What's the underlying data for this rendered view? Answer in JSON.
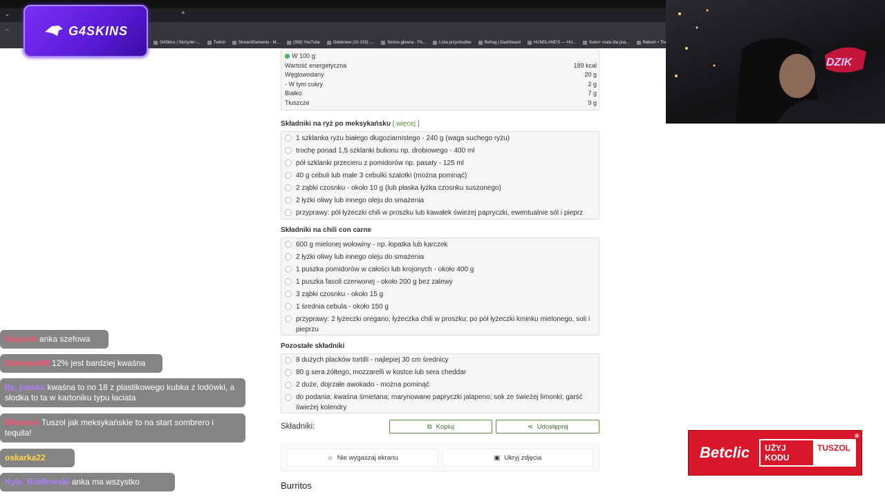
{
  "browser": {
    "new_tab_glyph": "+",
    "nav_back": "←",
    "nav_forward": "→",
    "nav_reload": "↻",
    "bookmarks": [
      {
        "label": "G4Skins | Skrzynki -..."
      },
      {
        "label": "Twitch"
      },
      {
        "label": "StreamElements - M..."
      },
      {
        "label": "(358) YouTube"
      },
      {
        "label": "Odebrane (10 219) -..."
      },
      {
        "label": "Strona główna - FA..."
      },
      {
        "label": "Lista przychodów"
      },
      {
        "label": "Refrag | Dashboard"
      },
      {
        "label": "HUNDLAND'S — HU..."
      },
      {
        "label": "Kuko+ mata dla psa..."
      },
      {
        "label": "Reborn • The Ho"
      }
    ]
  },
  "overlay": {
    "sponsor_name": "G4SKINS",
    "cam_logo": "DZIK"
  },
  "nutrition": {
    "header": "W 100 g:",
    "rows": [
      {
        "name": "Wartość energetyczna",
        "value": "189 kcal"
      },
      {
        "name": "Węglowodany",
        "value": "20 g"
      },
      {
        "name": "- W tym cukry",
        "value": "2 g"
      },
      {
        "name": "Białko",
        "value": "7 g"
      },
      {
        "name": "Tłuszcze",
        "value": "9 g"
      }
    ]
  },
  "sections": [
    {
      "title": "Składniki na ryż po meksykańsku",
      "more": "[ więcej ]",
      "items": [
        "1 szklanka ryżu białego długoziarnistego - 240 g (waga suchego ryżu)",
        "trochę ponad 1,5 szklanki bulionu np. drobiowego - 400 ml",
        "pół szklanki przecieru z pomidorów np. pasaty - 125 ml",
        "40 g cebuli lub małe 3 cebulki szalotki (można pominąć)",
        "2 ząbki czosnku - około 10 g (lub płaska łyżka czosnku suszonego)",
        "2 łyżki oliwy lub innego oleju do smażenia",
        "przyprawy: pół łyżeczki chili w proszku lub kawałek świeżej papryczki, ewentualnie sól i pieprz"
      ]
    },
    {
      "title": "Składniki na chili con carne",
      "more": "",
      "items": [
        "600 g mielonej wołowiny - np. łopatka lub karczek",
        "2 łyżki oliwy lub innego oleju do smażenia",
        "1 puszka pomidorów w całości lub krojonych - około 400 g",
        "1 puszka fasoli czerwonej - około 200 g bez zalewy",
        "3 ząbki czosnku - około 15 g",
        "1 średnia cebula - około 150 g",
        "przyprawy: 2 łyżeczki oregano; łyżeczka chili w proszku; po pół łyżeczki kminku mielonego, soli i pieprzu"
      ]
    },
    {
      "title": "Pozostałe składniki",
      "more": "",
      "items": [
        "8 dużych placków tortilli - najlepiej 30 cm średnicy",
        "80 g sera żółtego, mozzarelli w kostce lub sera cheddar",
        "2 duże, dojrzałe awokado - można pominąć",
        "do podania: kwaśna śmietana; marynowane papryczki jalapeno; sok ze świeżej limonki; garść świeżej kolendry"
      ]
    }
  ],
  "actions": {
    "label": "Składniki:",
    "copy": "Kopiuj",
    "share": "Udostępnij",
    "keep_screen": "Nie wygaszaj ekranu",
    "hide_photos": "Ukryj zdjęcia"
  },
  "next_title": "Burritos",
  "chat": [
    {
      "user": "Koyocik",
      "text": "anka szefowa",
      "color": "#ff4d6d"
    },
    {
      "user": "Doloress88",
      "text": "12% jest bardziej kwaśna",
      "color": "#ff4d6d"
    },
    {
      "user": "Its_jneska",
      "text": "kwaśna to no 18 z plastikowego kubka z lodówki, a słodka to ta w kartoniku typu łaciata",
      "color": "#b07cff"
    },
    {
      "user": "Wienson",
      "text": "Tuszol jak meksykańskie to na start sombrero i tequila!",
      "color": "#ff4d6d"
    },
    {
      "user": "oskarka22",
      "text": "",
      "color": "#ffd54a"
    },
    {
      "user": "Kyle_Broflowski",
      "text": "anka ma wszystko",
      "color": "#b07cff"
    }
  ],
  "betclic": {
    "logo": "Betclic",
    "code_label": "UŻYJ KODU",
    "code": "TUSZOL"
  },
  "colors": {
    "accent": "#5a8a3a",
    "betclic": "#d8172b",
    "g4skins": "#6d28d9"
  }
}
